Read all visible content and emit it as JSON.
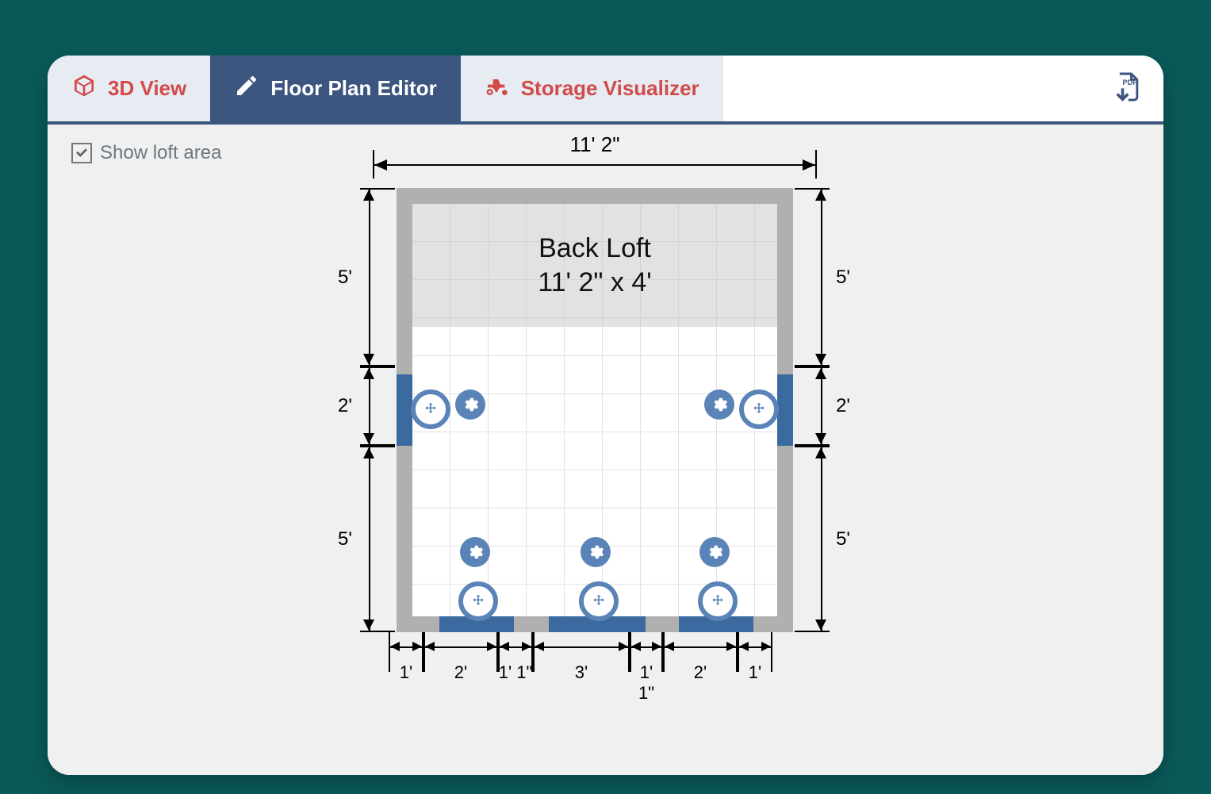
{
  "tabs": {
    "view3d": "3D View",
    "editor": "Floor Plan Editor",
    "storage": "Storage Visualizer"
  },
  "toolbar": {
    "show_loft": "Show loft area",
    "pdf_export": "Export PDF"
  },
  "plan": {
    "width_label": "11' 2\"",
    "loft_title": "Back Loft",
    "loft_dims": "11' 2\" x 4'",
    "left_dims": [
      "5'",
      "2'",
      "5'"
    ],
    "right_dims": [
      "5'",
      "2'",
      "5'"
    ],
    "bottom_dims": [
      "1'",
      "2'",
      "1' 1\"",
      "3'",
      "1' 1\"",
      "2'",
      "1'"
    ]
  }
}
